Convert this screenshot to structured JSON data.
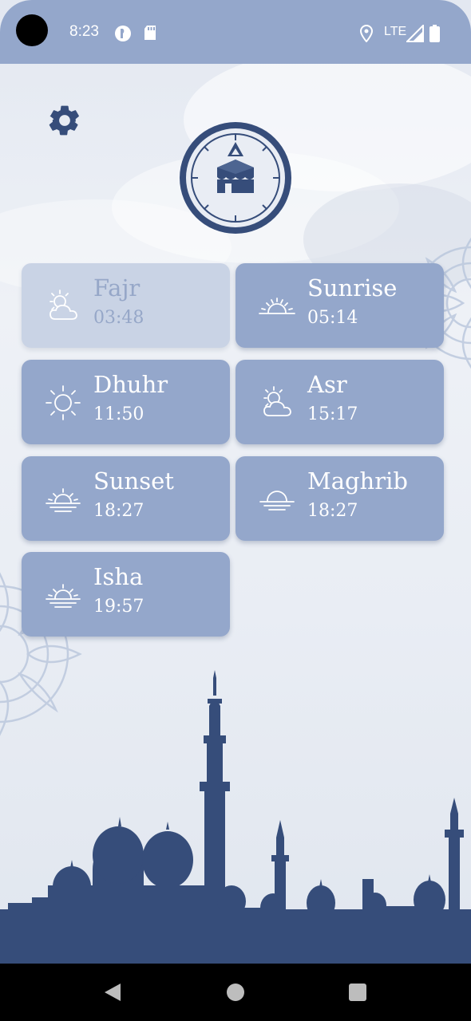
{
  "status_bar": {
    "time": "8:23",
    "network": "LTE",
    "icons": [
      "data-saver-icon",
      "sd-card-icon",
      "location-icon",
      "signal-icon",
      "battery-icon"
    ]
  },
  "header": {
    "settings_icon": "gear-icon",
    "logo_icon": "kaaba-compass-icon"
  },
  "prayers": [
    {
      "name": "Fajr",
      "time": "03:48",
      "icon": "partly-cloudy-icon",
      "passed": true
    },
    {
      "name": "Sunrise",
      "time": "05:14",
      "icon": "sunrise-icon",
      "passed": false
    },
    {
      "name": "Dhuhr",
      "time": "11:50",
      "icon": "sun-icon",
      "passed": false
    },
    {
      "name": "Asr",
      "time": "15:17",
      "icon": "partly-cloudy-icon",
      "passed": false
    },
    {
      "name": "Sunset",
      "time": "18:27",
      "icon": "sunset-icon",
      "passed": false
    },
    {
      "name": "Maghrib",
      "time": "18:27",
      "icon": "sun-horizon-icon",
      "passed": false
    },
    {
      "name": "Isha",
      "time": "19:57",
      "icon": "sunset-icon",
      "passed": false
    }
  ],
  "colors": {
    "accent": "#94a7cb",
    "accent_dim": "#c9d3e5",
    "dark_navy": "#364d7a",
    "status_bar": "#94a7cb"
  },
  "nav_bar": {
    "icons": [
      "back-icon",
      "home-icon",
      "recents-icon"
    ]
  }
}
